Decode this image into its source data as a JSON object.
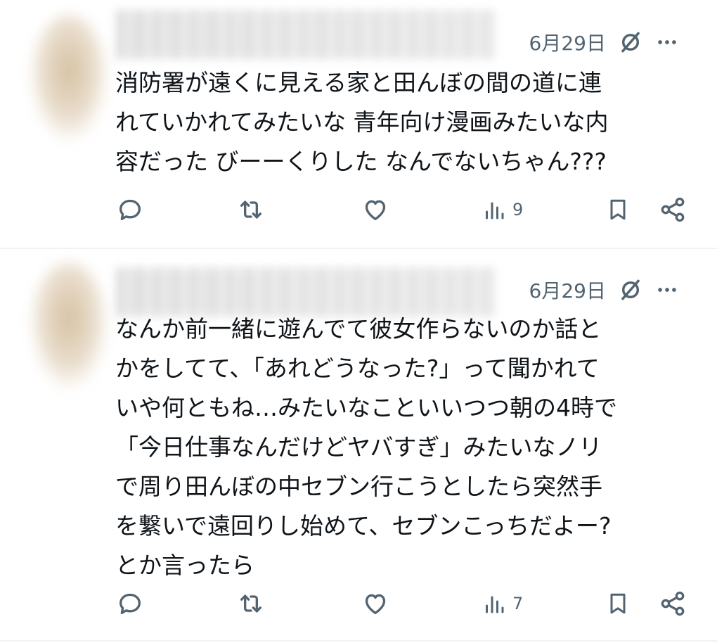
{
  "posts": [
    {
      "date": "6月29日",
      "text": "消防署が遠くに見える家と田んぼの間の道に連\nれていかれてみたいな 青年向け漫画みたいな内\n容だった びーーくりした なんでないちゃん???",
      "views": "9",
      "icons": [
        "grok-icon",
        "more-icon",
        "reply-icon",
        "repost-icon",
        "like-icon",
        "views-icon",
        "bookmark-icon",
        "share-icon"
      ]
    },
    {
      "date": "6月29日",
      "text": "なんか前一緒に遊んでて彼女作らないのか話と\nかをしてて、「あれどうなった?」って聞かれて\nいや何ともね…みたいなこといいつつ朝の4時で\n「今日仕事なんだけどヤバすぎ」みたいなノリ\nで周り田んぼの中セブン行こうとしたら突然手\nを繋いで遠回りし始めて、セブンこっちだよー?\nとか言ったら",
      "views": "7",
      "icons": [
        "grok-icon",
        "more-icon",
        "reply-icon",
        "repost-icon",
        "like-icon",
        "views-icon",
        "bookmark-icon",
        "share-icon"
      ]
    }
  ],
  "colors": {
    "text": "#0f1419",
    "muted": "#536471",
    "divider": "#eff3f4"
  }
}
